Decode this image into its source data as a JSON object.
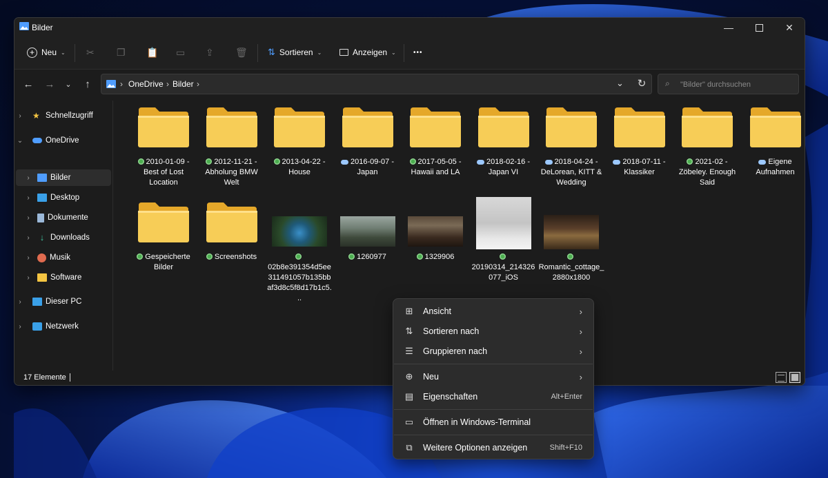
{
  "window": {
    "title": "Bilder"
  },
  "toolbar": {
    "new_label": "Neu",
    "sort_label": "Sortieren",
    "view_label": "Anzeigen",
    "more_label": "•••"
  },
  "address": {
    "crumbs": [
      "OneDrive",
      "Bilder"
    ]
  },
  "search": {
    "placeholder": "\"Bilder\" durchsuchen"
  },
  "sidebar": {
    "items": [
      {
        "label": "Schnellzugriff"
      },
      {
        "label": "OneDrive"
      },
      {
        "label": "Bilder"
      },
      {
        "label": "Desktop"
      },
      {
        "label": "Dokumente"
      },
      {
        "label": "Downloads"
      },
      {
        "label": "Musik"
      },
      {
        "label": "Software"
      },
      {
        "label": "Dieser PC"
      },
      {
        "label": "Netzwerk"
      }
    ]
  },
  "files": [
    {
      "name": "2010-01-09 - Best of Lost Location",
      "status": "synced"
    },
    {
      "name": "2012-11-21 - Abholung BMW Welt",
      "status": "synced"
    },
    {
      "name": "2013-04-22 - House",
      "status": "synced"
    },
    {
      "name": "2016-09-07 - Japan",
      "status": "cloud"
    },
    {
      "name": "2017-05-05 - Hawaii and LA",
      "status": "synced"
    },
    {
      "name": "2018-02-16 - Japan VI",
      "status": "cloud"
    },
    {
      "name": "2018-04-24 - DeLorean, KITT & Wedding",
      "status": "cloud"
    },
    {
      "name": "2018-07-11 - Klassiker",
      "status": "cloud"
    },
    {
      "name": "2021-02 - Zöbeley. Enough Said",
      "status": "synced"
    },
    {
      "name": "Eigene Aufnahmen",
      "status": "cloud"
    },
    {
      "name": "Gespeicherte Bilder",
      "status": "synced"
    },
    {
      "name": "Screenshots",
      "status": "synced"
    },
    {
      "name": "02b8e391354d5ee311491057b135bbaf3d8c5f8d17b1c5...",
      "status": "synced"
    },
    {
      "name": "1260977",
      "status": "synced"
    },
    {
      "name": "1329906",
      "status": "synced"
    },
    {
      "name": "20190314_214326077_iOS",
      "status": "synced"
    },
    {
      "name": "Romantic_cottage_2880x1800",
      "status": "synced"
    }
  ],
  "status": {
    "count_text": "17 Elemente"
  },
  "context_menu": {
    "items": [
      {
        "label": "Ansicht",
        "shortcut": "",
        "icon": "grid-icon"
      },
      {
        "label": "Sortieren nach",
        "shortcut": "",
        "icon": "sort-icon"
      },
      {
        "label": "Gruppieren nach",
        "shortcut": "",
        "icon": "group-icon"
      },
      {
        "label": "Neu",
        "shortcut": "",
        "icon": "new-icon"
      },
      {
        "label": "Eigenschaften",
        "shortcut": "Alt+Enter",
        "icon": "properties-icon"
      },
      {
        "label": "Öffnen in Windows-Terminal",
        "shortcut": "",
        "icon": "terminal-icon"
      },
      {
        "label": "Weitere Optionen anzeigen",
        "shortcut": "Shift+F10",
        "icon": "more-options-icon"
      }
    ]
  },
  "colors": {
    "folder": "#f5c542",
    "accent": "#4f9dff",
    "synced": "#4caf50",
    "cloud": "#9cc8ff"
  }
}
